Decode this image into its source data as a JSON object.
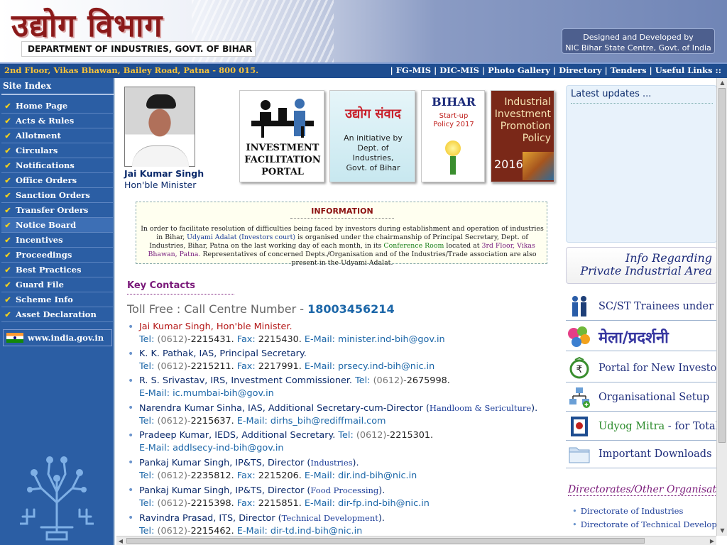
{
  "header": {
    "title_hindi": "उद्योग विभाग",
    "title_english": "DEPARTMENT OF INDUSTRIES, GOVT. OF BIHAR",
    "credit_line1": "Designed and Developed by",
    "credit_line2": "NIC Bihar State Centre, Govt. of India"
  },
  "addressbar": {
    "address": "2nd Floor, Vikas Bhawan, Bailey Road, Patna - 800 015.",
    "links": [
      "FG-MIS",
      "DIC-MIS",
      "Photo Gallery",
      "Directory",
      "Tenders",
      "Useful Links ::"
    ]
  },
  "sidebar": {
    "heading": "Site Index",
    "items": [
      "Home Page",
      "Acts & Rules",
      "Allotment",
      "Circulars",
      "Notifications",
      "Office Orders",
      "Sanction Orders",
      "Transfer Orders",
      "Notice Board",
      "Incentives",
      "Proceedings",
      "Best Practices",
      "Guard File",
      "Scheme Info",
      "Asset Declaration"
    ],
    "active_item": "Notice Board",
    "external_link": "www.india.gov.in"
  },
  "minister": {
    "name": "Jai Kumar Singh",
    "role": "Hon'ble Minister"
  },
  "banners": {
    "ifp": [
      "INVESTMENT",
      "FACILITATION",
      "PORTAL"
    ],
    "samvad_title": "उद्योग संवाद",
    "samvad_sub": [
      "An initiative by",
      "Dept. of",
      "Industries,",
      "Govt. of Bihar"
    ],
    "startup_title": "BIHAR",
    "startup_sub": [
      "Start-up",
      "Policy 2017"
    ],
    "iip": [
      "Industrial",
      "Investment",
      "Promotion",
      "Policy"
    ],
    "iip_year": "2016"
  },
  "information": {
    "title": "INFORMATION",
    "p1": "In order to facilitate resolution of difficulties being faced by investors during establishment and operation of industries in Bihar,",
    "udyami": "Udyami Adalat (Investors court)",
    "p2": "is organised under the chairmanship of Principal Secretary, Dept. of Industries, Bihar, Patna on the last working day of each month, in its",
    "room": "Conference Room",
    "p3": "located at",
    "location": "3rd Floor, Vikas Bhawan, Patna.",
    "p4": "Representatives of concerned Depts./Organisation and of the Industries/Trade association are also present in the Udyami Adalat."
  },
  "contacts": {
    "heading": "Key Contacts",
    "tollfree_label": "Toll Free : Call Centre Number -",
    "tollfree_number": "18003456214",
    "people": [
      {
        "name": "Jai Kumar Singh, Hon'ble Minister.",
        "tel_code": "(0612)-",
        "tel": "2215431.",
        "fax": "2215430.",
        "email": "minister.ind-bih@gov.in"
      },
      {
        "name": "K. K. Pathak, IAS, Principal Secretary.",
        "tel_code": "(0612)-",
        "tel": "2215211.",
        "fax": "2217991.",
        "email": "prsecy.ind-bih@nic.in"
      },
      {
        "name": "R. S. Srivastav, IRS, Investment Commissioner.",
        "tel_code": "(0612)-",
        "tel": "2675998.",
        "email": "ic.mumbai-bih@gov.in"
      },
      {
        "name": "Narendra Kumar Sinha, IAS, Additional Secretary-cum-Director (",
        "dept": "Handloom & Sericulture",
        "tail": ").",
        "tel_code": "(0612)-",
        "tel": "2215637.",
        "email": "dirhs_bih@rediffmail.com"
      },
      {
        "name": "Pradeep Kumar, IEDS, Additional Secretary.",
        "tel_code": "(0612)-",
        "tel": "2215301.",
        "email": "addlsecy-ind-bih@gov.in"
      },
      {
        "name": "Pankaj Kumar Singh, IP&TS, Director (",
        "dept": "Industries",
        "tail": ").",
        "tel_code": "(0612)-",
        "tel": "2235812.",
        "fax": "2215206.",
        "email": "dir.ind-bih@nic.in"
      },
      {
        "name": "Pankaj Kumar Singh, IP&TS, Director (",
        "dept": "Food Processing",
        "tail": ").",
        "tel_code": "(0612)-",
        "tel": "2215398.",
        "fax": "2215851.",
        "email": "dir-fp.ind-bih@nic.in"
      },
      {
        "name": "Ravindra Prasad, ITS, Director (",
        "dept": "Technical Development",
        "tail": ").",
        "tel_code": "(0612)-",
        "tel": "2215462.",
        "email": "dir-td.ind-bih@nic.in"
      }
    ],
    "tel_label": "Tel:",
    "fax_label": "Fax:",
    "email_label": "E-Mail:"
  },
  "right": {
    "latest_updates": "Latest updates ...",
    "info_regarding": [
      "Info Regarding",
      "Private Industrial Area"
    ],
    "quicklinks": [
      {
        "icon": "people-icon",
        "label": "SC/ST Trainees under Sk"
      },
      {
        "icon": "balloons-icon",
        "label": "मेला/प्रदर्शनी"
      },
      {
        "icon": "rupee-icon",
        "label": "Portal for New Investors"
      },
      {
        "icon": "org-chart-icon",
        "label": "Organisational Setup"
      },
      {
        "icon": "udyog-mitra-icon",
        "label": "Udyog Mitra",
        "suffix": " - for Total A"
      },
      {
        "icon": "folder-icon",
        "label": "Important Downloads"
      }
    ],
    "directorates_title": "Directorates/Other Organisatio",
    "directorates": [
      "Directorate of Industries",
      "Directorate of Technical Developmen"
    ]
  },
  "colors": {
    "sidebar_bg": "#2b5ea4",
    "addressbar_bg": "#1e4d90",
    "address_text": "#f7c23a",
    "header_title": "#8b1a1a"
  }
}
